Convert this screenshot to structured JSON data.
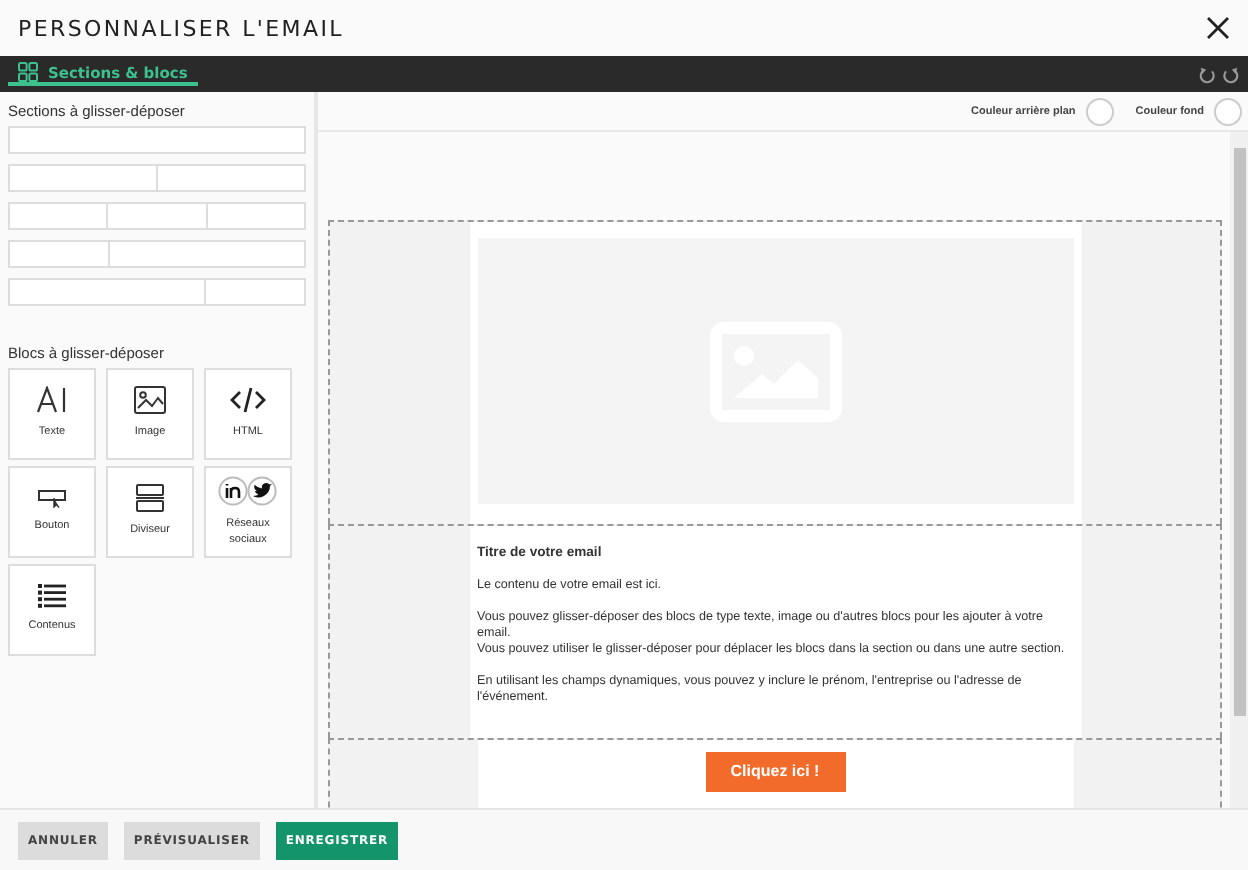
{
  "window": {
    "title": "PERSONNALISER L'EMAIL"
  },
  "tabs": [
    {
      "label": "Sections & blocs",
      "selected": true
    }
  ],
  "sidebar": {
    "sections_title": "Sections à glisser-déposer",
    "sections": [
      {
        "kind": "one"
      },
      {
        "kind": "two"
      },
      {
        "kind": "three"
      },
      {
        "kind": "one-two"
      },
      {
        "kind": "two-one"
      }
    ],
    "blocks_title": "Blocs à glisser-déposer",
    "blocks": [
      {
        "kind": "text",
        "label": "Texte"
      },
      {
        "kind": "image",
        "label": "Image"
      },
      {
        "kind": "html",
        "label": "HTML"
      },
      {
        "kind": "button",
        "label": "Bouton"
      },
      {
        "kind": "divider",
        "label": "Diviseur"
      },
      {
        "kind": "social",
        "label": "Réseaux sociaux"
      },
      {
        "kind": "list",
        "label": "Contenus"
      }
    ]
  },
  "canvas": {
    "color_options": [
      {
        "label": "Couleur arrière plan"
      },
      {
        "label": "Couleur fond"
      }
    ],
    "email": {
      "title": "Titre de votre email",
      "paragraphs": [
        [
          "Le contenu de votre email est ici."
        ],
        [
          "Vous pouvez glisser-déposer des blocs de type texte, image ou d'autres blocs pour les ajouter à votre email.",
          "Vous pouvez utiliser le glisser-déposer pour déplacer les blocs dans la section ou dans une autre section."
        ],
        [
          "En utilisant les champs dynamiques, vous pouvez y inclure le prénom, l'entreprise ou l'adresse de l'événement."
        ]
      ],
      "button": "Cliquez ici !"
    }
  },
  "footer": {
    "buttons": [
      {
        "label": "ANNULER",
        "kind": "secondary"
      },
      {
        "label": "PRÉVISUALISER",
        "kind": "secondary"
      },
      {
        "label": "ENREGISTRER",
        "kind": "primary"
      }
    ]
  }
}
